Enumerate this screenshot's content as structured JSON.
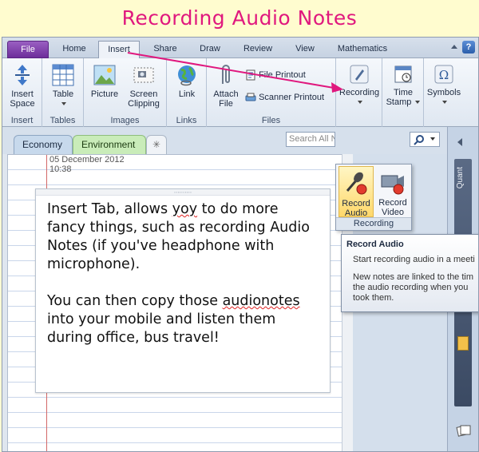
{
  "banner": {
    "title": "Recording Audio Notes"
  },
  "ribbon_tabs": [
    "File",
    "Home",
    "Insert",
    "Share",
    "Draw",
    "Review",
    "View",
    "Mathematics"
  ],
  "help_label": "?",
  "groups": {
    "insert": {
      "label": "Insert",
      "insert_space": "Insert Space"
    },
    "tables": {
      "label": "Tables",
      "table": "Table"
    },
    "images": {
      "label": "Images",
      "picture": "Picture",
      "screen_clipping": "Screen Clipping"
    },
    "links": {
      "label": "Links",
      "link": "Link"
    },
    "files": {
      "label": "Files",
      "attach_file": "Attach File",
      "file_printout": "File Printout",
      "scanner_printout": "Scanner Printout"
    },
    "recording": {
      "label": "Recording"
    },
    "time_stamp": "Time Stamp",
    "symbols": "Symbols"
  },
  "sections": {
    "tab1": "Economy",
    "tab2": "Environment",
    "new_tab": "✳"
  },
  "search": {
    "placeholder": "Search All N"
  },
  "page": {
    "date": "05 December 2012",
    "time": "10:38"
  },
  "note": {
    "para1": [
      "Insert Tab, allows ",
      "yoy",
      " to do more fancy things, such as recording Audio Notes (if you've headphone with microphone)."
    ],
    "para2": [
      "You can then copy those ",
      "audionotes",
      " into your mobile and listen them during office, bus travel!"
    ]
  },
  "flyout": {
    "record_audio": "Record Audio",
    "record_video": "Record Video",
    "label": "Recording"
  },
  "tooltip": {
    "title": "Record Audio",
    "line1": "Start recording audio in a meeti",
    "line2": "New notes are linked to the tim",
    "line3": "the audio recording when you",
    "line4": "took them."
  },
  "sidebar": {
    "label": "Quant"
  },
  "colors": {
    "accent": "#e0187e",
    "file_tab": "#7a3aa8",
    "margin": "#d36868"
  }
}
